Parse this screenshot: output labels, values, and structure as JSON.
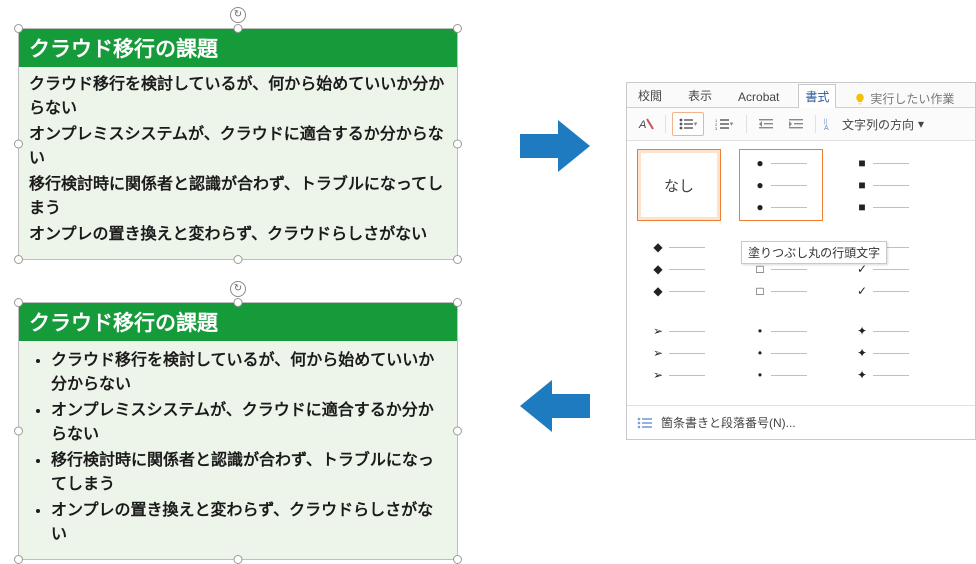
{
  "box": {
    "title": "クラウド移行の課題",
    "items": [
      "クラウド移行を検討しているが、何から始めていいか分からない",
      "オンプレミスシステムが、クラウドに適合するか分からない",
      "移行検討時に関係者と認識が合わず、トラブルになってしまう",
      "オンプレの置き換えと変わらず、クラウドらしさがない"
    ]
  },
  "ribbon": {
    "tabs": {
      "review": "校閲",
      "view": "表示",
      "acrobat": "Acrobat",
      "format": "書式"
    },
    "tell_me": "実行したい作業",
    "text_direction": "文字列の方向",
    "gallery": {
      "none_label": "なし",
      "tooltip": "塗りつぶし丸の行頭文字",
      "footer": "箇条書きと段落番号(N)..."
    }
  },
  "colors": {
    "accent_green": "#169b3b",
    "arrow_blue": "#1f7bbf",
    "highlight": "#ed7d31"
  }
}
